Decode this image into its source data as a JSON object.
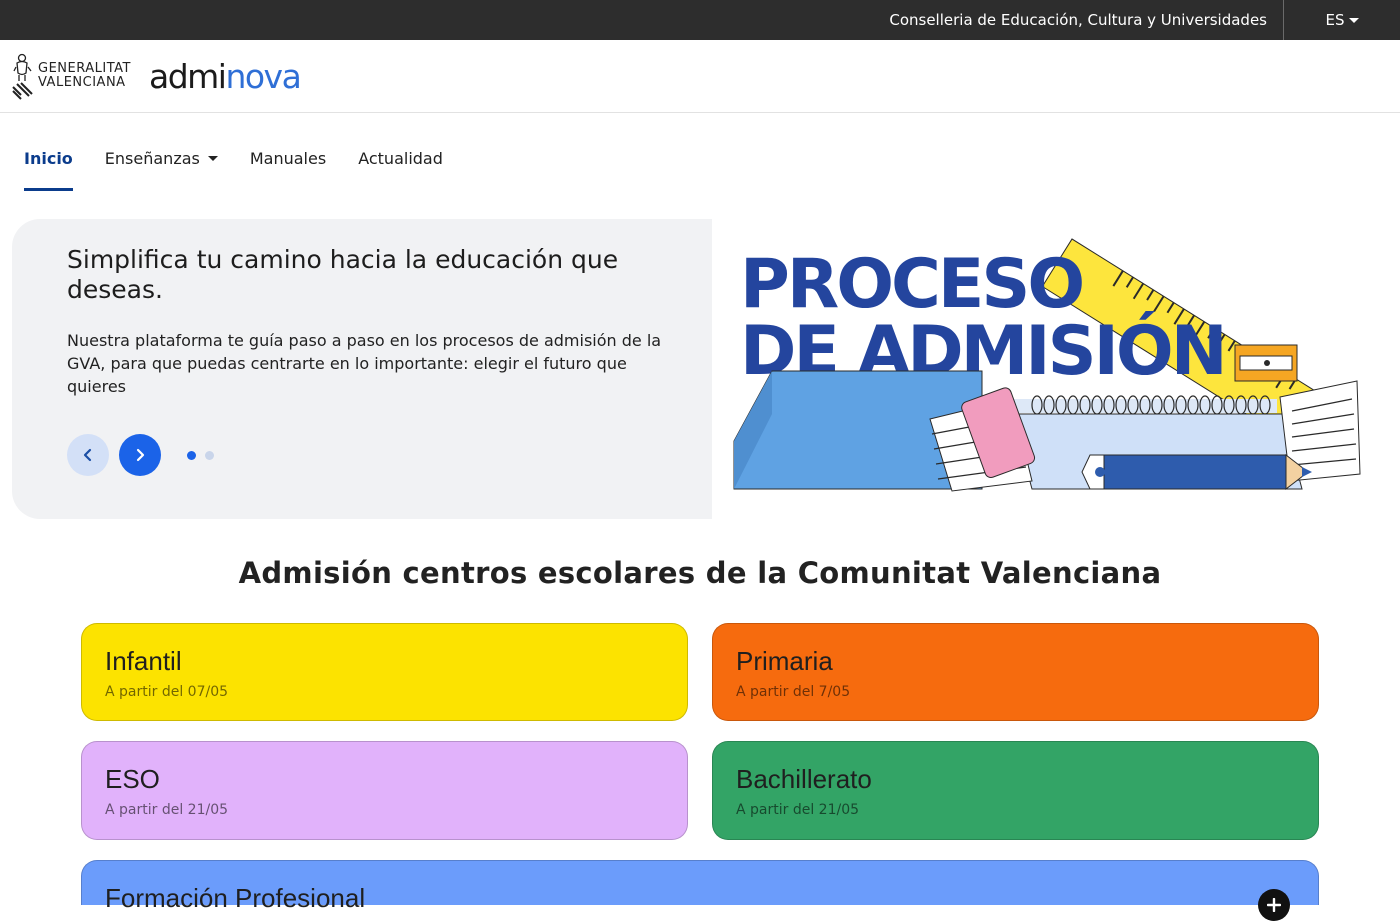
{
  "topbar": {
    "department": "Conselleria de Educación, Cultura y Universidades",
    "language": "ES"
  },
  "header": {
    "gva_line1": "GENERALITAT",
    "gva_line2": "VALENCIANA",
    "brand_part1": "admi",
    "brand_part2": "nova"
  },
  "nav": {
    "items": [
      {
        "label": "Inicio"
      },
      {
        "label": "Enseñanzas"
      },
      {
        "label": "Manuales"
      },
      {
        "label": "Actualidad"
      }
    ]
  },
  "hero": {
    "title": "Simplifica tu camino hacia la educación que deseas.",
    "description": "Nuestra plataforma te guía paso a paso en los procesos de admisión de la GVA, para que puedas centrarte en lo importante: elegir el futuro que quieres",
    "prev_icon": "chevron-left-icon",
    "next_icon": "chevron-right-icon",
    "active_slide": 1,
    "slide_count": 2,
    "banner_line1": "PROCESO",
    "banner_line2": "DE ADMISIÓN"
  },
  "section": {
    "title": "Admisión centros escolares de la Comunitat Valenciana"
  },
  "cards": [
    {
      "title": "Infantil",
      "date": "A partir del 07/05",
      "color": "#fce300"
    },
    {
      "title": "Primaria",
      "date": "A partir del 7/05",
      "color": "#f66b0e"
    },
    {
      "title": "ESO",
      "date": "A partir del 21/05",
      "color": "#e1b2fb"
    },
    {
      "title": "Bachillerato",
      "date": "A partir del 21/05",
      "color": "#33a466"
    },
    {
      "title": "Formación Profesional",
      "color": "#6b9cfb",
      "icon": "plus-icon"
    }
  ],
  "colors": {
    "primary": "#0b3c8c",
    "accent": "#1b63e8",
    "topbar": "#2d2d2d"
  }
}
